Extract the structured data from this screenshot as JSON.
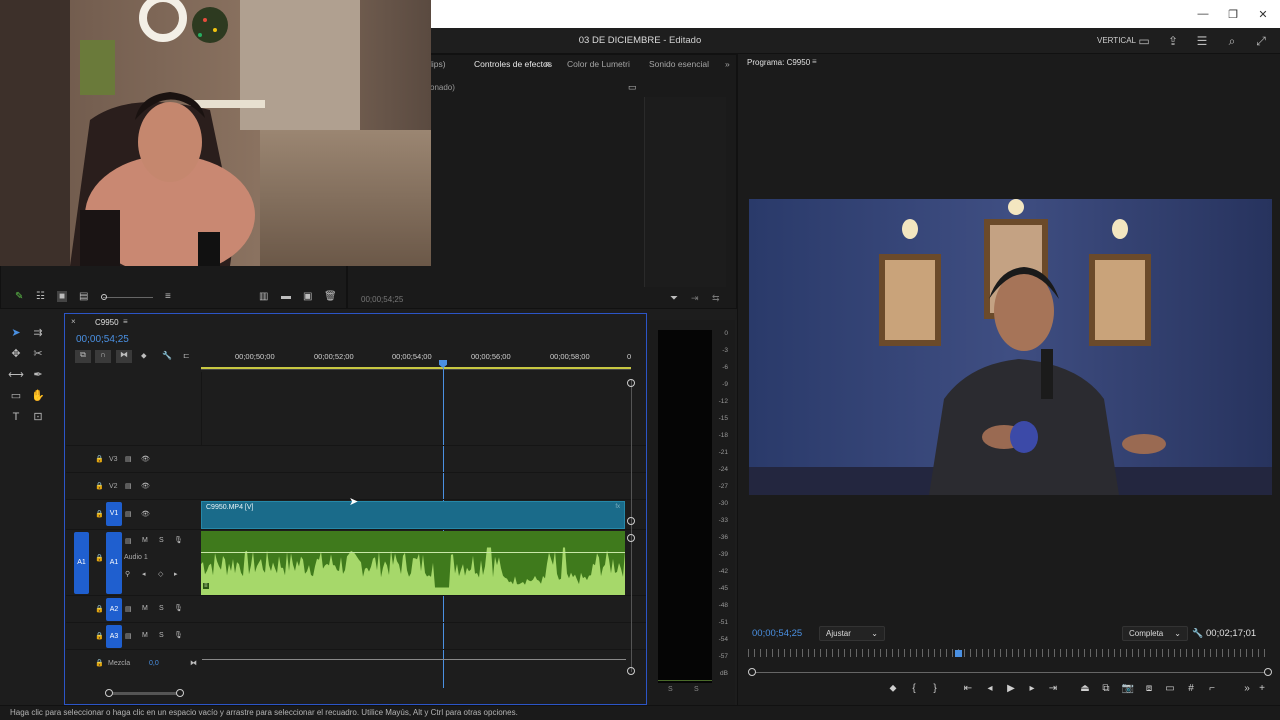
{
  "window": {
    "title": "03 DE DICIEMBRE",
    "title_suffix": " - Editado",
    "controls": [
      "—",
      "❐",
      "✕"
    ],
    "workspace": "VERTICAL"
  },
  "source_panel": {
    "tabs": [
      "lips)",
      "Controles de efectos",
      "Color de Lumetri",
      "Sonido esencial"
    ],
    "active_tab": "Controles de efectos",
    "subtitle": "onado)",
    "timecode": "00;00;54;25"
  },
  "timeline": {
    "sequence_name": "C9950",
    "timecode": "00;00;54;25",
    "ruler": [
      "00;00;50;00",
      "00;00;52;00",
      "00;00;54;00",
      "00;00;56;00",
      "00;00;58;00",
      "0"
    ],
    "video_tracks": [
      {
        "id": "V3"
      },
      {
        "id": "V2"
      },
      {
        "id": "V1",
        "target": "V1"
      }
    ],
    "video_clip": "C9950.MP4 [V]",
    "audio_tracks": [
      {
        "id": "A1",
        "target": "A1",
        "name": "Audio 1",
        "m": "M",
        "s": "S"
      },
      {
        "id": "A2",
        "m": "M",
        "s": "S"
      },
      {
        "id": "A3",
        "m": "M",
        "s": "S"
      }
    ],
    "mix_label": "Mezcla",
    "mix_value": "0,0"
  },
  "audio_meter": {
    "scale": [
      "0",
      "-3",
      "-6",
      "-9",
      "-12",
      "-15",
      "-18",
      "-21",
      "-24",
      "-27",
      "-30",
      "-33",
      "-36",
      "-39",
      "-42",
      "-45",
      "-48",
      "-51",
      "-54",
      "-57",
      "dB"
    ],
    "solo": [
      "S",
      "S"
    ]
  },
  "program": {
    "title": "Programa: C9950",
    "timecode": "00;00;54;25",
    "fit": "Ajustar",
    "quality": "Completa",
    "duration": "00;02;17;01",
    "playhead_fraction": 0.4
  },
  "status": "Haga clic para seleccionar o haga clic en un espacio vacío y arrastre para seleccionar el recuadro. Utilice Mayús, Alt y Ctrl para otras opciones.",
  "colors": {
    "accent": "#2c55c7",
    "video_clip": "#1a6b8a",
    "audio_clip": "#3f7a1c",
    "waveform": "#a6d86a",
    "timecode": "#4a90e2"
  }
}
